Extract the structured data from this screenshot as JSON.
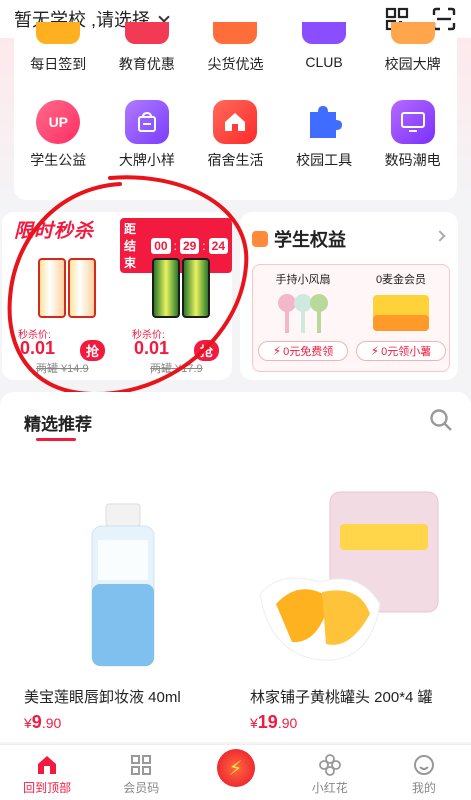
{
  "header": {
    "school_label": "暂无学校 ,请选择"
  },
  "quick_nav": {
    "row1": [
      {
        "label": "每日签到",
        "color": "#ffb020"
      },
      {
        "label": "教育优惠",
        "color": "#f23a55"
      },
      {
        "label": "尖货优选",
        "color": "#ff6d3a"
      },
      {
        "label": "CLUB",
        "color": "#8a4dff"
      },
      {
        "label": "校园大牌",
        "color": "#ffa64d"
      }
    ],
    "row2": [
      {
        "label": "学生公益",
        "icon_text": "UP",
        "color": "#ff3f6c"
      },
      {
        "label": "大牌小样",
        "icon_text": "",
        "color": "#9b5cff"
      },
      {
        "label": "宿舍生活",
        "icon_text": "",
        "color": "#ff3b3b"
      },
      {
        "label": "校园工具",
        "icon_text": "",
        "color": "#4a7bff"
      },
      {
        "label": "数码潮电",
        "icon_text": "",
        "color": "#9a4dff"
      }
    ]
  },
  "flash_sale": {
    "title": "限时秒杀",
    "countdown_label": "距结束",
    "hours": "00",
    "minutes": "29",
    "seconds": "24",
    "products": [
      {
        "tag": "秒杀价:",
        "price": "0.01",
        "button": "抢",
        "original": "两罐 ¥14.9"
      },
      {
        "tag": "秒杀价:",
        "price": "0.01",
        "button": "抢",
        "original": "两罐 ¥17.9"
      }
    ]
  },
  "student_rights": {
    "title": "学生权益",
    "items": [
      {
        "name": "手持小风扇",
        "button": "0元免费领"
      },
      {
        "name": "0麦金会员",
        "button": "0元领小薯"
      }
    ]
  },
  "recommend": {
    "title": "精选推荐",
    "products": [
      {
        "name": "美宝莲眼唇卸妆液 40ml",
        "price_int": "9",
        "price_dec": ".90"
      },
      {
        "name": "林家铺子黄桃罐头 200*4 罐",
        "price_int": "19",
        "price_dec": ".90"
      }
    ]
  },
  "tabbar": {
    "items": [
      {
        "label": "回到顶部"
      },
      {
        "label": "会员码"
      },
      {
        "label": ""
      },
      {
        "label": "小红花"
      },
      {
        "label": "我的"
      }
    ]
  },
  "colors": {
    "accent": "#f21b3f",
    "annotation": "#e8141c"
  }
}
